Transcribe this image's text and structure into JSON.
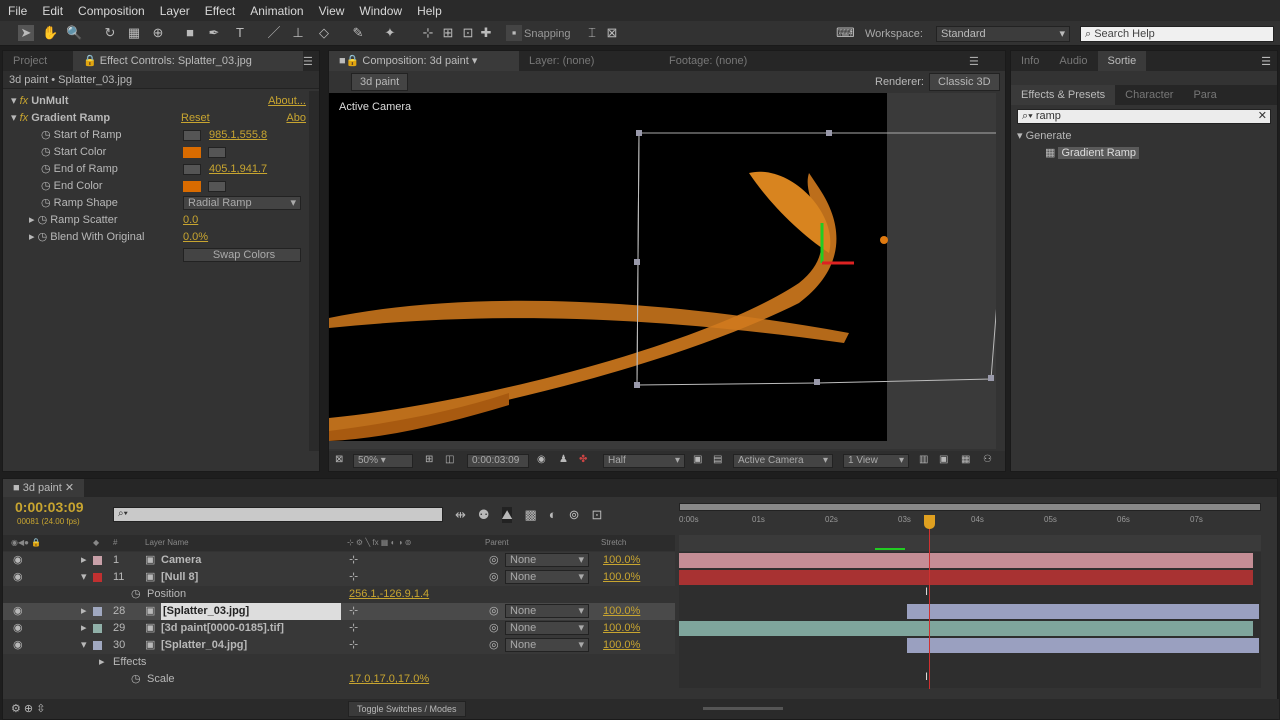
{
  "menu": [
    "File",
    "Edit",
    "Composition",
    "Layer",
    "Effect",
    "Animation",
    "View",
    "Window",
    "Help"
  ],
  "toolbar": {
    "snapping": "Snapping",
    "workspace_label": "Workspace:",
    "workspace": "Standard",
    "search_placeholder": "Search Help"
  },
  "left_panel": {
    "tabs": [
      "Project",
      "Effect Controls: Splatter_03.jpg"
    ],
    "breadcrumb": "3d paint • Splatter_03.jpg",
    "effects": [
      {
        "name": "UnMult",
        "link": "About..."
      },
      {
        "name": "Gradient Ramp",
        "reset": "Reset",
        "link": "Abo"
      }
    ],
    "props": [
      {
        "label": "Start of Ramp",
        "value": "985.1,555.8"
      },
      {
        "label": "Start Color"
      },
      {
        "label": "End of Ramp",
        "value": "405.1,941.7"
      },
      {
        "label": "End Color"
      },
      {
        "label": "Ramp Shape",
        "value": "Radial Ramp"
      },
      {
        "label": "Ramp Scatter",
        "value": "0.0"
      },
      {
        "label": "Blend With Original",
        "value": "0.0%"
      }
    ],
    "swap": "Swap Colors",
    "color": "#d96b00"
  },
  "viewer": {
    "tab": "Composition: 3d paint",
    "layer_tab": "Layer: (none)",
    "footage_tab": "Footage: (none)",
    "comp_button": "3d paint",
    "renderer_label": "Renderer:",
    "renderer": "Classic 3D",
    "camera_label": "Active Camera",
    "zoom": "50%",
    "time": "0:00:03:09",
    "resolution": "Half",
    "view": "Active Camera",
    "views": "1 View"
  },
  "right_panel": {
    "tabs": [
      "Info",
      "Audio",
      "Sortie"
    ],
    "tabs2": [
      "Effects & Presets",
      "Character",
      "Para"
    ],
    "search": "ramp",
    "category": "Generate",
    "item": "Gradient Ramp"
  },
  "timeline": {
    "tab": "3d paint",
    "timecode": "0:00:03:09",
    "frames": "00081 (24.00 fps)",
    "headers": {
      "name": "Layer Name",
      "parent": "Parent",
      "stretch": "Stretch",
      "num": "#"
    },
    "ruler": [
      "0:00s",
      "01s",
      "02s",
      "03s",
      "04s",
      "05s",
      "06s",
      "07s"
    ],
    "layers": [
      {
        "num": "1",
        "name": "Camera",
        "label": "#c8a0a8",
        "parent": "None",
        "stretch": "100.0%",
        "expanded": false
      },
      {
        "num": "11",
        "name": "[Null 8]",
        "label": "#c03030",
        "parent": "None",
        "stretch": "100.0%",
        "expanded": true
      },
      {
        "prop": "Position",
        "value": "256.1,-126.9,1.4"
      },
      {
        "num": "28",
        "name": "[Splatter_03.jpg]",
        "label": "#a0a8c0",
        "parent": "None",
        "stretch": "100.0%",
        "expanded": false,
        "selected": true
      },
      {
        "num": "29",
        "name": "[3d paint[0000-0185].tif]",
        "label": "#90b0a8",
        "parent": "None",
        "stretch": "100.0%",
        "expanded": false
      },
      {
        "num": "30",
        "name": "[Splatter_04.jpg]",
        "label": "#a0a8c0",
        "parent": "None",
        "stretch": "100.0%",
        "expanded": true
      },
      {
        "group": "Effects"
      },
      {
        "prop": "Scale",
        "value": "17.0,17.0,17.0%"
      }
    ],
    "toggle": "Toggle Switches / Modes"
  }
}
